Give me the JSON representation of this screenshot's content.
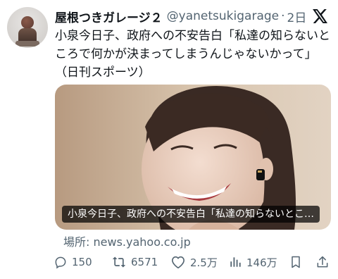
{
  "tweet": {
    "author_name": "屋根つきガレージ２",
    "handle": "@yanetsukigarage",
    "separator": "·",
    "time": "2日",
    "text": "小泉今日子、政府への不安告白「私達の知らないところで何かが決まってしまうんじゃないかって」（日刊スポーツ）"
  },
  "card": {
    "headline": "小泉今日子、政府への不安告白「私達の知らないとこ…",
    "source_label": "場所:",
    "source_domain": "news.yahoo.co.jp"
  },
  "actions": {
    "replies": "150",
    "reposts": "6571",
    "likes": "2.5万",
    "views": "146万"
  },
  "icons": {
    "reply": "reply-icon",
    "repost": "repost-icon",
    "like": "heart-icon",
    "views": "views-chart-icon",
    "bookmark": "bookmark-icon",
    "share": "share-icon",
    "brand": "x-logo-icon"
  },
  "colors": {
    "text_primary": "#0f1419",
    "text_secondary": "#536471",
    "background": "#ffffff"
  }
}
